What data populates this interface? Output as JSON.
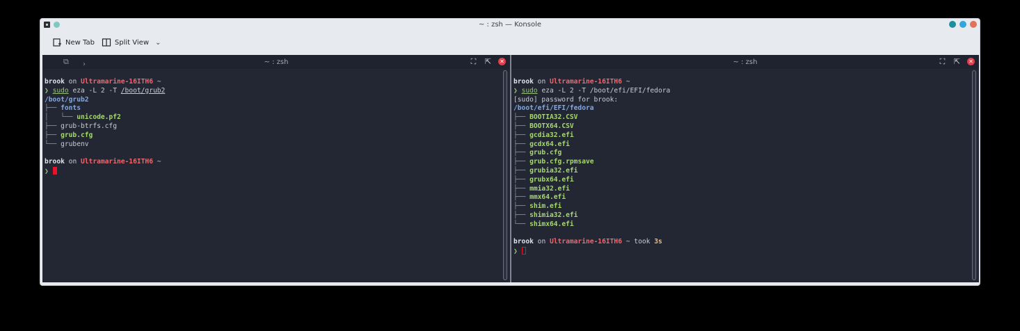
{
  "window": {
    "title": "~ : zsh — Konsole"
  },
  "toolbar": {
    "new_tab_label": "New Tab",
    "split_view_label": "Split View"
  },
  "left_pane": {
    "header_title": "~ : zsh",
    "lines": [
      {
        "user": "brook",
        "on": " on ",
        "host": "Ultramarine-16ITH6",
        "tail": " ~"
      },
      {
        "prompt": "❯ ",
        "sudo": "sudo",
        "rest": " eza -L 2 -T ",
        "path": "/boot/grub2"
      },
      {
        "dir": "/boot/grub2"
      },
      {
        "tree": "├── ",
        "dir": "fonts"
      },
      {
        "tree": "│   └── ",
        "file": "unicode.pf2"
      },
      {
        "tree": "├── ",
        "plain": "grub-btrfs.cfg"
      },
      {
        "tree": "├── ",
        "file": "grub.cfg"
      },
      {
        "tree": "└── ",
        "plain": "grubenv"
      },
      {},
      {
        "user": "brook",
        "on": " on ",
        "host": "Ultramarine-16ITH6",
        "tail": " ~"
      },
      {
        "prompt": "❯ ",
        "cursor": "filled"
      }
    ]
  },
  "right_pane": {
    "header_title": "~ : zsh",
    "lines": [
      {
        "user": "brook",
        "on": " on ",
        "host": "Ultramarine-16ITH6",
        "tail": " ~"
      },
      {
        "prompt": "❯ ",
        "sudo": "sudo",
        "rest": " eza -L 2 -T /boot/efi/EFI/fedora"
      },
      {
        "plain": "[sudo] password for brook:"
      },
      {
        "dirpath": "/boot/efi/EFI/",
        "dir": "fedora"
      },
      {
        "tree": "├── ",
        "file": "BOOTIA32.CSV"
      },
      {
        "tree": "├── ",
        "file": "BOOTX64.CSV"
      },
      {
        "tree": "├── ",
        "file": "gcdia32.efi"
      },
      {
        "tree": "├── ",
        "file": "gcdx64.efi"
      },
      {
        "tree": "├── ",
        "file": "grub.cfg"
      },
      {
        "tree": "├── ",
        "file": "grub.cfg.rpmsave"
      },
      {
        "tree": "├── ",
        "file": "grubia32.efi"
      },
      {
        "tree": "├── ",
        "file": "grubx64.efi"
      },
      {
        "tree": "├── ",
        "file": "mmia32.efi"
      },
      {
        "tree": "├── ",
        "file": "mmx64.efi"
      },
      {
        "tree": "├── ",
        "file": "shim.efi"
      },
      {
        "tree": "├── ",
        "file": "shimia32.efi"
      },
      {
        "tree": "└── ",
        "file": "shimx64.efi"
      },
      {},
      {
        "user": "brook",
        "on": " on ",
        "host": "Ultramarine-16ITH6",
        "tail": " ~ took ",
        "took": "3s"
      },
      {
        "prompt": "❯ ",
        "cursor": "hollow"
      }
    ]
  },
  "colors": {
    "terminal_bg": "#232734",
    "host": "#f0666b",
    "prompt": "#98c379",
    "directory": "#7fa9e8",
    "file": "#a6d86e",
    "cursor": "#e8132b"
  }
}
